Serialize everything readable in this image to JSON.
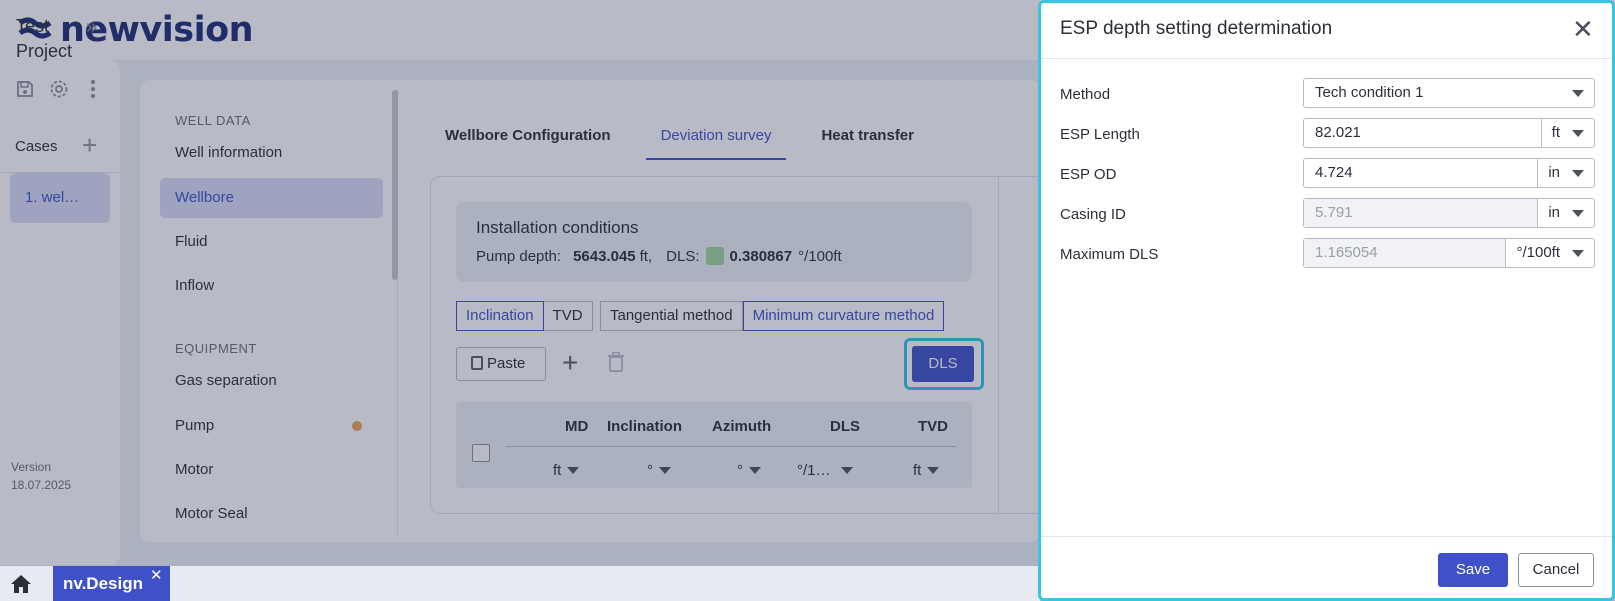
{
  "app": {
    "logo_text": "newvision",
    "brand_color": "#1e2a78",
    "accent_color": "#3f51c9",
    "highlight_color": "#35c6e0"
  },
  "project": {
    "name": "Test Project",
    "cases_label": "Cases",
    "cases": [
      {
        "label": "1. wel…"
      }
    ],
    "version_label": "Version",
    "version_date": "18.07.2025"
  },
  "nav": {
    "sections": [
      {
        "title": "WELL DATA",
        "items": [
          "Well information",
          "Wellbore",
          "Fluid",
          "Inflow"
        ]
      },
      {
        "title": "EQUIPMENT",
        "items": [
          "Gas separation",
          "Pump",
          "Motor",
          "Motor Seal"
        ]
      }
    ],
    "active_item": "Wellbore",
    "pump_status_color": "#f0a057"
  },
  "tabs": [
    {
      "label": "Wellbore Configuration"
    },
    {
      "label": "Deviation survey"
    },
    {
      "label": "Heat transfer"
    }
  ],
  "active_tab": "Deviation survey",
  "installation": {
    "title": "Installation conditions",
    "pump_depth_label": "Pump depth:",
    "pump_depth_value": "5643.045",
    "pump_depth_unit": "ft,",
    "dls_label": "DLS:",
    "dls_value": "0.380867",
    "dls_unit": "°/100ft",
    "dls_status_color": "#9ed79a"
  },
  "mode_toggle": [
    "Inclination",
    "TVD"
  ],
  "method_toggle": [
    "Tangential method",
    "Minimum curvature method"
  ],
  "toolbar": {
    "paste_label": "Paste",
    "dls_label": "DLS"
  },
  "table": {
    "columns": [
      {
        "header": "MD",
        "unit": "ft"
      },
      {
        "header": "Inclination",
        "unit": "°"
      },
      {
        "header": "Azimuth",
        "unit": "°"
      },
      {
        "header": "DLS",
        "unit": "°/1…"
      },
      {
        "header": "TVD",
        "unit": "ft"
      }
    ]
  },
  "taskbar": {
    "tab_label": "nv.Design"
  },
  "dialog": {
    "title": "ESP depth setting determination",
    "fields": {
      "method": {
        "label": "Method",
        "value": "Tech condition 1"
      },
      "esp_length": {
        "label": "ESP Length",
        "value": "82.021",
        "unit": "ft"
      },
      "esp_od": {
        "label": "ESP OD",
        "value": "4.724",
        "unit": "in"
      },
      "casing_id": {
        "label": "Casing ID",
        "value": "5.791",
        "unit": "in"
      },
      "max_dls": {
        "label": "Maximum DLS",
        "value": "1.165054",
        "unit": "°/100ft"
      }
    },
    "save_label": "Save",
    "cancel_label": "Cancel"
  }
}
